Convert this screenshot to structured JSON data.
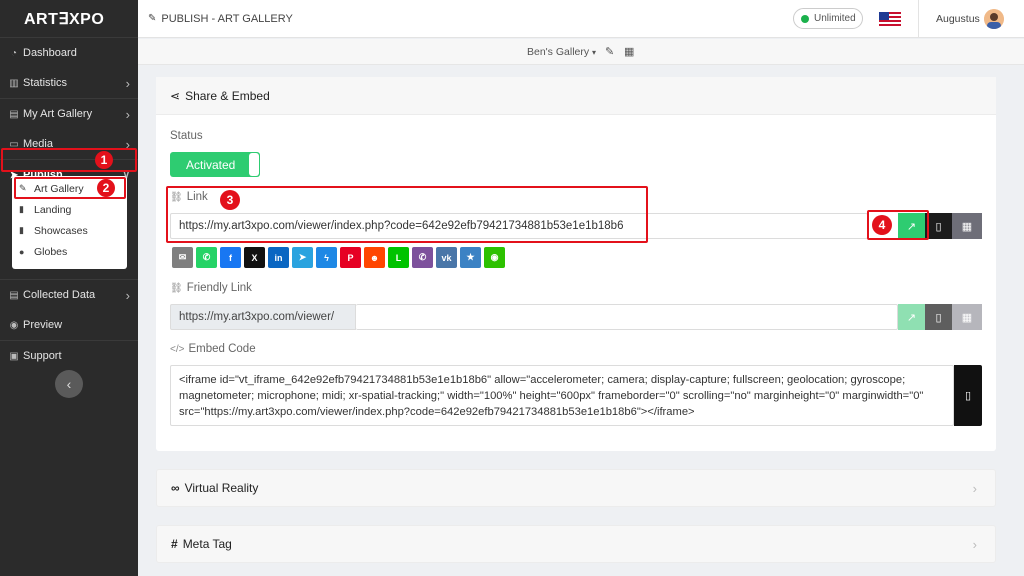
{
  "app": {
    "logo": "ART∃XPO"
  },
  "sidebar": {
    "items": [
      {
        "label": "Dashboard",
        "icon": "dashboard-icon"
      },
      {
        "label": "Statistics",
        "icon": "chart-icon"
      },
      {
        "label": "My Art Gallery",
        "icon": "gallery-icon"
      },
      {
        "label": "Media",
        "icon": "monitor-icon"
      },
      {
        "label": "Publish",
        "icon": "send-icon"
      },
      {
        "label": "Collected Data",
        "icon": "database-icon"
      },
      {
        "label": "Preview",
        "icon": "eye-icon"
      },
      {
        "label": "Support",
        "icon": "support-icon"
      }
    ],
    "publish_submenu": [
      {
        "label": "Art Gallery",
        "icon": "art-gallery-icon"
      },
      {
        "label": "Landing",
        "icon": "file-icon"
      },
      {
        "label": "Showcases",
        "icon": "file-icon"
      },
      {
        "label": "Globes",
        "icon": "globe-icon"
      }
    ]
  },
  "header": {
    "title": "PUBLISH - ART GALLERY",
    "plan": "Unlimited",
    "plan_color": "#1bb14c",
    "username": "Augustus"
  },
  "gallery_bar": {
    "selected_gallery": "Ben's Gallery"
  },
  "share_embed": {
    "title": "Share & Embed",
    "status_label": "Status",
    "status_value": "Activated",
    "link_label": "Link",
    "link_url": "https://my.art3xpo.com/viewer/index.php?code=642e92efb79421734881b53e1e1b18b6",
    "friendly_link_label": "Friendly Link",
    "friendly_link_prefix": "https://my.art3xpo.com/viewer/",
    "friendly_link_value": "",
    "embed_label": "Embed Code",
    "embed_code": "<iframe id=\"vt_iframe_642e92efb79421734881b53e1e1b18b6\" allow=\"accelerometer; camera; display-capture; fullscreen; geolocation; gyroscope; magnetometer; microphone; midi; xr-spatial-tracking;\" width=\"100%\" height=\"600px\" frameborder=\"0\" scrolling=\"no\" marginheight=\"0\" marginwidth=\"0\" src=\"https://my.art3xpo.com/viewer/index.php?code=642e92efb79421734881b53e1e1b18b6\"></iframe>",
    "share_buttons": [
      {
        "name": "email",
        "glyph": "✉",
        "color": "#7f7f7f"
      },
      {
        "name": "whatsapp",
        "glyph": "✆",
        "color": "#25d366"
      },
      {
        "name": "facebook",
        "glyph": "f",
        "color": "#1877f2"
      },
      {
        "name": "x",
        "glyph": "X",
        "color": "#111111"
      },
      {
        "name": "linkedin",
        "glyph": "in",
        "color": "#0a66c2"
      },
      {
        "name": "telegram",
        "glyph": "➤",
        "color": "#2aa3df"
      },
      {
        "name": "messenger",
        "glyph": "ϟ",
        "color": "#1e88e5"
      },
      {
        "name": "pinterest",
        "glyph": "P",
        "color": "#e60023"
      },
      {
        "name": "reddit",
        "glyph": "☻",
        "color": "#ff4500"
      },
      {
        "name": "line",
        "glyph": "L",
        "color": "#00c300"
      },
      {
        "name": "viber",
        "glyph": "✆",
        "color": "#7d519c"
      },
      {
        "name": "vk",
        "glyph": "vk",
        "color": "#4a76a8"
      },
      {
        "name": "favorites",
        "glyph": "★",
        "color": "#3b82c4"
      },
      {
        "name": "wechat",
        "glyph": "◉",
        "color": "#2dc100"
      }
    ]
  },
  "sections": [
    {
      "title": "Virtual Reality",
      "icon": "vr-glasses-icon"
    },
    {
      "title": "Meta Tag",
      "icon": "hashtag-icon"
    }
  ],
  "annotations": [
    "1",
    "2",
    "3",
    "4"
  ],
  "annotation_color": "#e3111b"
}
